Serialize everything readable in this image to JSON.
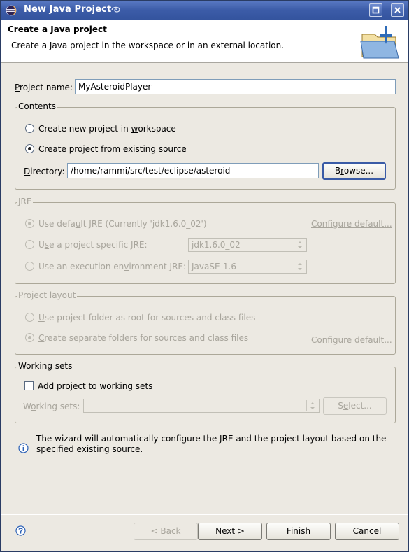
{
  "window": {
    "title": "New Java Project"
  },
  "header": {
    "title": "Create a Java project",
    "description": "Create a Java project in the workspace or in an external location."
  },
  "project_name": {
    "label_prefix": "P",
    "label_rest": "roject name:",
    "value": "MyAsteroidPlayer"
  },
  "contents": {
    "group_title": "Contents",
    "option_workspace": {
      "pre": "Create new project in ",
      "u": "w",
      "post": "orkspace",
      "checked": false
    },
    "option_existing": {
      "pre": "Create project from e",
      "u": "x",
      "post": "isting source",
      "checked": true
    },
    "directory_label": {
      "u": "D",
      "post": "irectory:"
    },
    "directory_value": "/home/rammi/src/test/eclipse/asteroid",
    "browse_button": {
      "pre": "B",
      "u": "r",
      "post": "owse..."
    }
  },
  "jre": {
    "group_title": "JRE",
    "option_default": {
      "pre": "Use defa",
      "u": "u",
      "post": "lt JRE (Currently 'jdk1.6.0_02')"
    },
    "configure_default_link": "Configure default...",
    "option_specific": {
      "pre": "U",
      "u": "s",
      "post": "e a project specific JRE:"
    },
    "specific_value": "jdk1.6.0_02",
    "option_env": {
      "pre": "Use an execution en",
      "u": "v",
      "post": "ironment JRE:"
    },
    "env_value": "JavaSE-1.6"
  },
  "layout": {
    "group_title": "Project layout",
    "option_root": {
      "pre": "",
      "u": "U",
      "post": "se project folder as root for sources and class files"
    },
    "option_separate": {
      "pre": "",
      "u": "C",
      "post": "reate separate folders for sources and class files"
    },
    "configure_default_link": "Configure default..."
  },
  "working_sets": {
    "group_title": "Working sets",
    "add_checkbox": {
      "pre": "Add projec",
      "u": "t",
      "post": " to working sets",
      "checked": false
    },
    "sets_label": {
      "pre": "W",
      "u": "o",
      "post": "rking sets:"
    },
    "select_button": {
      "pre": "S",
      "u": "e",
      "post": "lect..."
    }
  },
  "info": {
    "line1": "The wizard will automatically configure the JRE and the project layout based on the",
    "line2": "specified existing source."
  },
  "footer": {
    "back_button": {
      "pre": "< ",
      "u": "B",
      "post": "ack"
    },
    "next_button": {
      "pre": "",
      "u": "N",
      "post": "ext >"
    },
    "finish_button": {
      "pre": "",
      "u": "F",
      "post": "inish"
    },
    "cancel_button": "Cancel"
  },
  "icons": {
    "app": "eclipse-icon",
    "maximize": "maximize-icon",
    "close": "close-icon",
    "banner": "java-project-folder-icon",
    "info": "info-icon",
    "help": "help-icon"
  }
}
